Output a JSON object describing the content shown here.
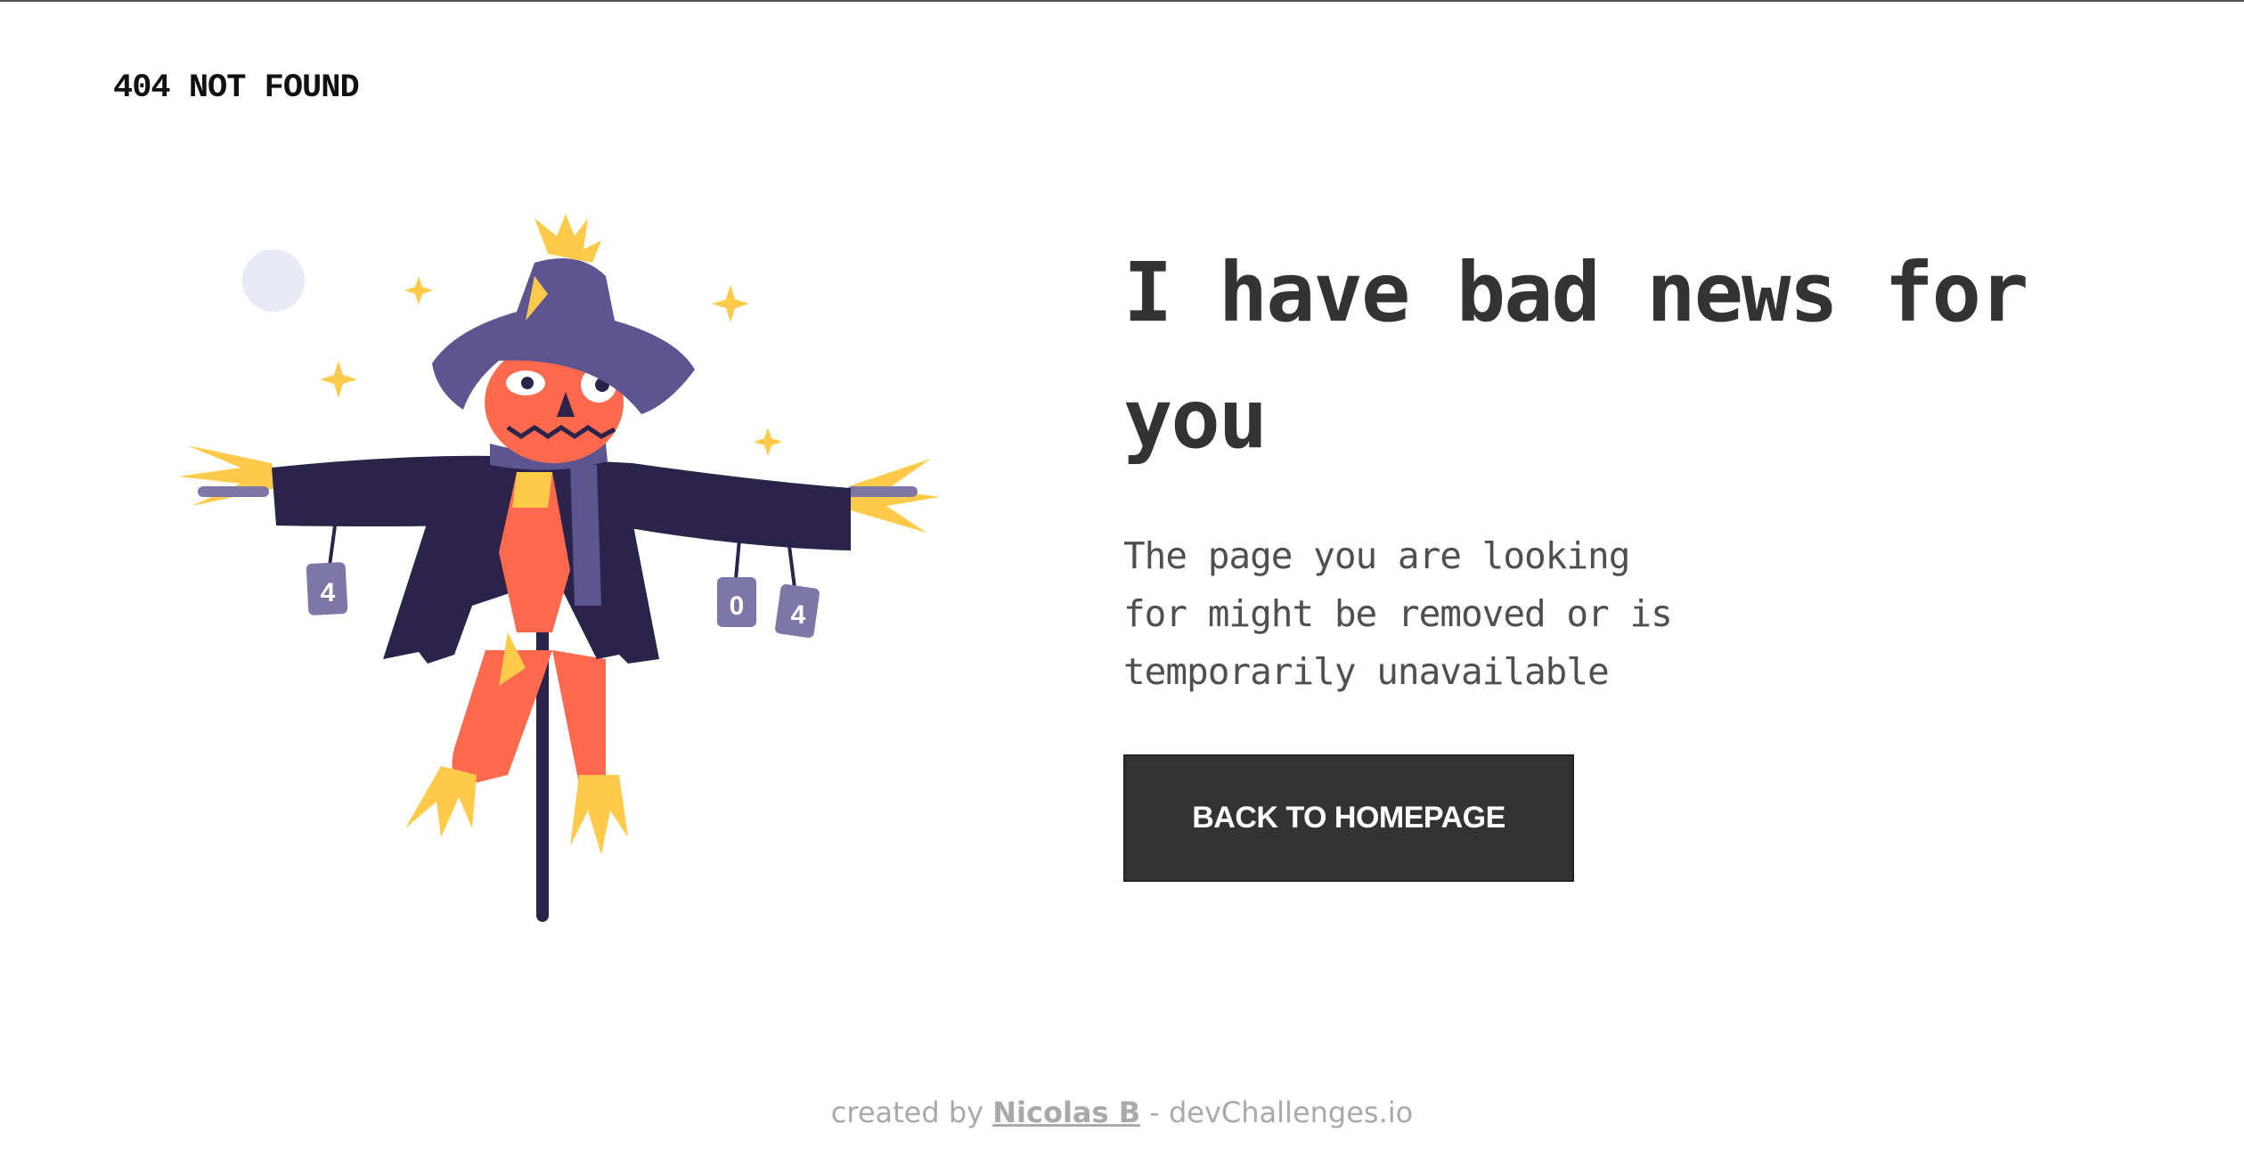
{
  "header": {
    "brand": "404 NOT FOUND"
  },
  "illustration": {
    "description_name": "scarecrow",
    "can_labels": [
      "4",
      "0",
      "4"
    ]
  },
  "main": {
    "headline": "I have bad news for you",
    "description": "The page you are looking for might be removed or is temporarily unavailable",
    "button_label": "BACK TO HOMEPAGE"
  },
  "footer": {
    "prefix": "created by",
    "author": "Nicolas B",
    "separator": "-",
    "site": "devChallenges.io"
  },
  "colors": {
    "text_dark": "#333333",
    "button_bg": "#333333",
    "hat": "#5e5490",
    "coat": "#2b2349",
    "face": "#ff6a4f",
    "straw": "#ffca4a",
    "moon": "#e8ebf5"
  }
}
